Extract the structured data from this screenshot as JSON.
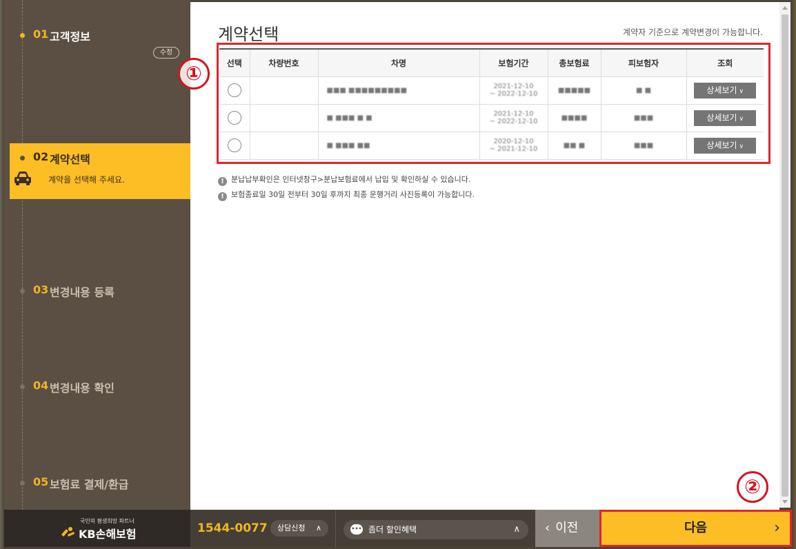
{
  "sidebar": {
    "steps": [
      {
        "num": "01",
        "title": "고객정보",
        "action": "수정"
      },
      {
        "num": "02",
        "title": "계약선택",
        "subtitle": "계약을 선택해 주세요."
      },
      {
        "num": "03",
        "title": "변경내용 등록"
      },
      {
        "num": "04",
        "title": "변경내용 확인"
      },
      {
        "num": "05",
        "title": "보험료 결제/환급"
      }
    ]
  },
  "main": {
    "title": "계약선택",
    "note": "계약자 기준으로 계약변경이 가능합니다.",
    "table": {
      "headers": [
        "선택",
        "차량번호",
        "차명",
        "보험기간",
        "총보험료",
        "피보험자",
        "조회"
      ],
      "rows": [
        {
          "vehicle_no": "",
          "car_name": "■■■ ■■■■■■■■■",
          "period_start": "2021-12-10",
          "period_end": "~ 2022-12-10",
          "premium": "■■■■■",
          "insured": "■ ■",
          "action": "상세보기"
        },
        {
          "vehicle_no": "",
          "car_name": "■ ■■■ ■ ■",
          "period_start": "2021-12-10",
          "period_end": "~ 2022-12-10",
          "premium": "■■■■",
          "insured": "■■■",
          "action": "상세보기"
        },
        {
          "vehicle_no": "",
          "car_name": "■ ■■■ ■■",
          "period_start": "2020-12-10",
          "period_end": "~ 2021-12-10",
          "premium": "■■ ■",
          "insured": "■■■",
          "action": "상세보기"
        }
      ]
    },
    "notices": [
      "분납납부확인은 인터넷창구>분납보험료에서 납입 및 확인하실 수 있습니다.",
      "보험종료일 30일 전부터 30일 후까지 최종 운행거리 사진등록이 가능합니다."
    ],
    "markers": [
      "①",
      "②"
    ]
  },
  "footer": {
    "tagline": "국민의 평생희망 파트너",
    "logo": "KB손해보험",
    "phone": "1544-0077",
    "consult_label": "상담신청",
    "discount_label": "좀더 할인혜택",
    "prev_label": "이전",
    "next_label": "다음"
  },
  "colors": {
    "accent": "#fdbd25",
    "highlight_red": "#e0242b",
    "sidebar_bg": "#5a4f42"
  }
}
